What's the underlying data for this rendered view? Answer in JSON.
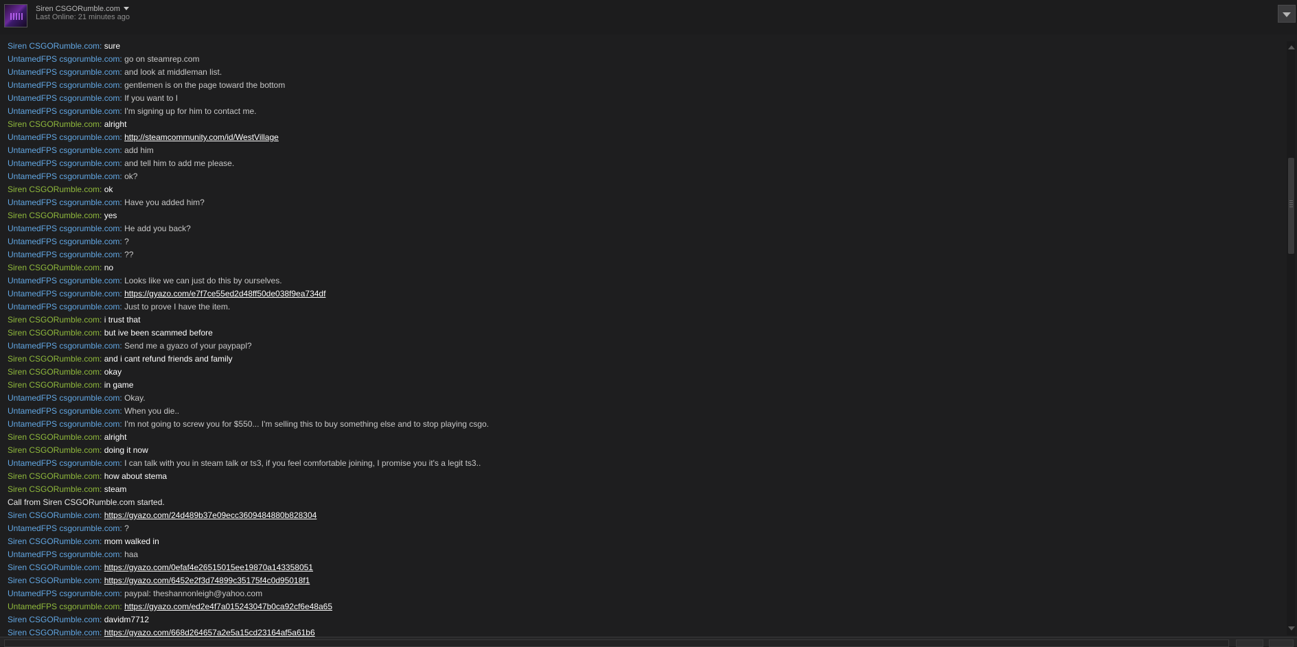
{
  "header": {
    "friend_name": "Siren CSGORumble.com",
    "status": "Last Online: 21 minutes ago"
  },
  "colors": {
    "blue_sender": "#62a7e3",
    "green_sender": "#90ba3c",
    "background": "#1e1e1f"
  },
  "messages": [
    {
      "sender": "Siren CSGORumble.com",
      "color": "blue",
      "text": "sure"
    },
    {
      "sender": "UntamedFPS csgorumble.com",
      "color": "blue",
      "text": "go on steamrep.com"
    },
    {
      "sender": "UntamedFPS csgorumble.com",
      "color": "blue",
      "text": "and look at middleman list."
    },
    {
      "sender": "UntamedFPS csgorumble.com",
      "color": "blue",
      "text": "gentlemen is on the page toward the bottom"
    },
    {
      "sender": "UntamedFPS csgorumble.com",
      "color": "blue",
      "text": "If you want to I"
    },
    {
      "sender": "UntamedFPS csgorumble.com",
      "color": "blue",
      "text": "I'm signing up for him to contact me."
    },
    {
      "sender": "Siren CSGORumble.com",
      "color": "green",
      "text": "alright"
    },
    {
      "sender": "UntamedFPS csgorumble.com",
      "color": "blue",
      "text": "http://steamcommunity.com/id/WestVillage",
      "link": true
    },
    {
      "sender": "UntamedFPS csgorumble.com",
      "color": "blue",
      "text": "add him"
    },
    {
      "sender": "UntamedFPS csgorumble.com",
      "color": "blue",
      "text": "and tell him to add me please."
    },
    {
      "sender": "UntamedFPS csgorumble.com",
      "color": "blue",
      "text": "ok?"
    },
    {
      "sender": "Siren CSGORumble.com",
      "color": "green",
      "text": "ok"
    },
    {
      "sender": "UntamedFPS csgorumble.com",
      "color": "blue",
      "text": "Have you added him?"
    },
    {
      "sender": "Siren CSGORumble.com",
      "color": "green",
      "text": "yes"
    },
    {
      "sender": "UntamedFPS csgorumble.com",
      "color": "blue",
      "text": "He add you back?"
    },
    {
      "sender": "UntamedFPS csgorumble.com",
      "color": "blue",
      "text": "?"
    },
    {
      "sender": "UntamedFPS csgorumble.com",
      "color": "blue",
      "text": "??"
    },
    {
      "sender": "Siren CSGORumble.com",
      "color": "green",
      "text": "no"
    },
    {
      "sender": "UntamedFPS csgorumble.com",
      "color": "blue",
      "text": "Looks like we can just do this by ourselves."
    },
    {
      "sender": "UntamedFPS csgorumble.com",
      "color": "blue",
      "text": "https://gyazo.com/e7f7ce55ed2d48ff50de038f9ea734df",
      "link": true
    },
    {
      "sender": "UntamedFPS csgorumble.com",
      "color": "blue",
      "text": "Just to prove I have the item."
    },
    {
      "sender": "Siren CSGORumble.com",
      "color": "green",
      "text": "i trust that"
    },
    {
      "sender": "Siren CSGORumble.com",
      "color": "green",
      "text": "but ive been scammed before"
    },
    {
      "sender": "UntamedFPS csgorumble.com",
      "color": "blue",
      "text": "Send me a gyazo of your paypapl?"
    },
    {
      "sender": "Siren CSGORumble.com",
      "color": "green",
      "text": "and i cant refund friends and family"
    },
    {
      "sender": "Siren CSGORumble.com",
      "color": "green",
      "text": "okay"
    },
    {
      "sender": "Siren CSGORumble.com",
      "color": "green",
      "text": "in game"
    },
    {
      "sender": "UntamedFPS csgorumble.com",
      "color": "blue",
      "text": "Okay."
    },
    {
      "sender": "UntamedFPS csgorumble.com",
      "color": "blue",
      "text": "When you die.."
    },
    {
      "sender": "UntamedFPS csgorumble.com",
      "color": "blue",
      "text": "I'm not going to screw you for $550... I'm selling this to buy something else and to stop playing csgo."
    },
    {
      "sender": "Siren CSGORumble.com",
      "color": "green",
      "text": "alright"
    },
    {
      "sender": "Siren CSGORumble.com",
      "color": "green",
      "text": "doing it now"
    },
    {
      "sender": "UntamedFPS csgorumble.com",
      "color": "blue",
      "text": "I can talk with you in steam talk or ts3, if you feel comfortable joining, I promise you it's a legit ts3.."
    },
    {
      "sender": "Siren CSGORumble.com",
      "color": "green",
      "text": "how about stema"
    },
    {
      "sender": "Siren CSGORumble.com",
      "color": "green",
      "text": "steam"
    },
    {
      "system": "Call from Siren CSGORumble.com started."
    },
    {
      "sender": "Siren CSGORumble.com",
      "color": "blue",
      "text": "https://gyazo.com/24d489b37e09ecc3609484880b828304",
      "link": true
    },
    {
      "sender": "UntamedFPS csgorumble.com",
      "color": "blue",
      "text": "?"
    },
    {
      "sender": "Siren CSGORumble.com",
      "color": "blue",
      "text": "mom walked in"
    },
    {
      "sender": "UntamedFPS csgorumble.com",
      "color": "blue",
      "text": "haa"
    },
    {
      "sender": "Siren CSGORumble.com",
      "color": "blue",
      "text": "https://gyazo.com/0efaf4e26515015ee19870a143358051",
      "link": true
    },
    {
      "sender": "Siren CSGORumble.com",
      "color": "blue",
      "text": "https://gyazo.com/6452e2f3d74899c35175f4c0d95018f1",
      "link": true
    },
    {
      "sender": "UntamedFPS csgorumble.com",
      "color": "blue",
      "text": "paypal: theshannonleigh@yahoo.com"
    },
    {
      "sender": "UntamedFPS csgorumble.com",
      "color": "green",
      "text": "https://gyazo.com/ed2e4f7a015243047b0ca92cf6e48a65",
      "link": true
    },
    {
      "sender": "Siren CSGORumble.com",
      "color": "blue",
      "text": "davidm7712"
    },
    {
      "sender": "Siren CSGORumble.com",
      "color": "blue",
      "text": "https://gyazo.com/668d264657a2e5a15cd23164af5a61b6",
      "link": true
    }
  ]
}
